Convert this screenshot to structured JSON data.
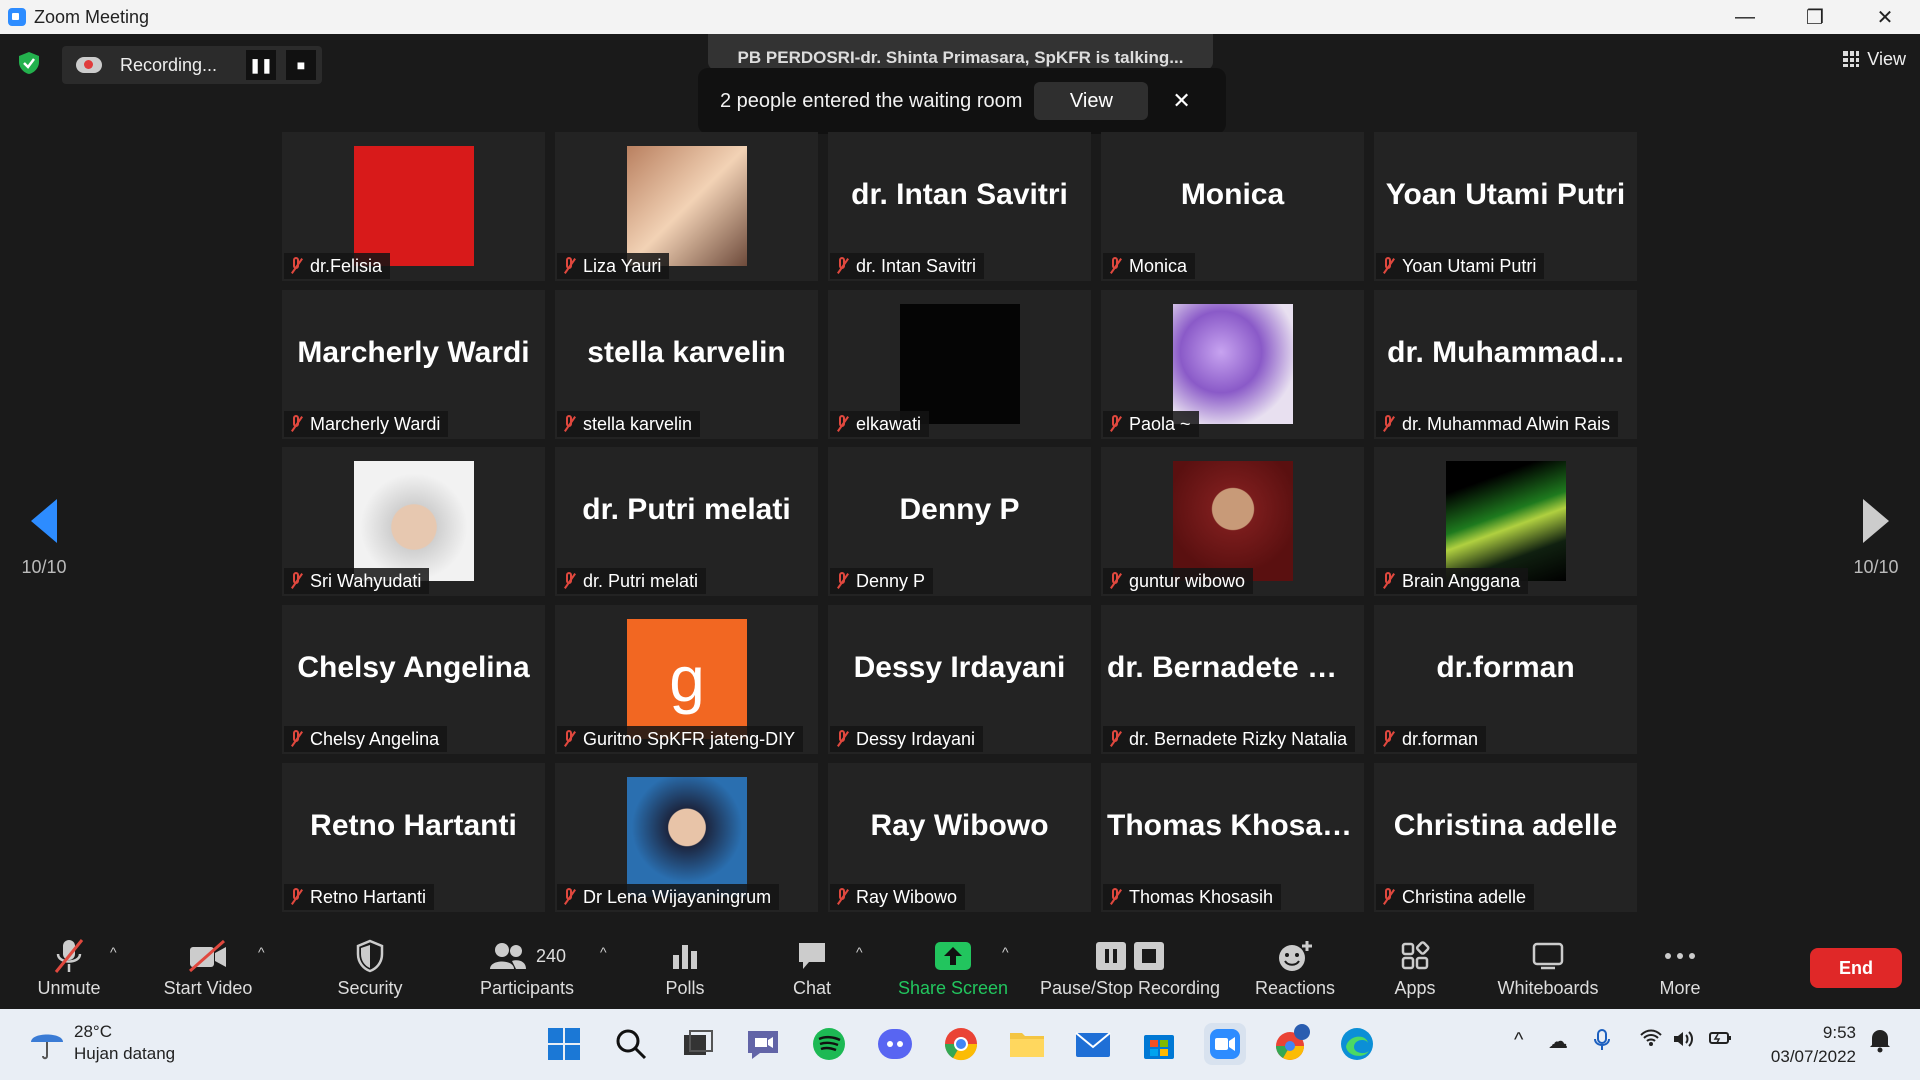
{
  "window": {
    "title": "Zoom Meeting",
    "min": "—",
    "max": "❐",
    "close": "✕"
  },
  "recording": {
    "text": "Recording...",
    "pause": "❚❚",
    "stop": "■"
  },
  "talking": {
    "text": "PB PERDOSRI-dr. Shinta Primasara, SpKFR is talking..."
  },
  "waiting_room": {
    "text": "2 people entered the waiting room",
    "view_label": "View",
    "close": "✕"
  },
  "view_menu": {
    "label": "View"
  },
  "pagination": {
    "left": "10/10",
    "right": "10/10"
  },
  "participants": [
    {
      "big": "",
      "label": "dr.Felisia",
      "pic": "photo"
    },
    {
      "big": "",
      "label": "Liza Yauri",
      "pic": "photo"
    },
    {
      "big": "dr. Intan Savitri",
      "label": "dr. Intan Savitri"
    },
    {
      "big": "Monica",
      "label": "Monica"
    },
    {
      "big": "Yoan Utami Putri",
      "label": "Yoan Utami Putri"
    },
    {
      "big": "Marcherly Wardi",
      "label": "Marcherly Wardi"
    },
    {
      "big": "stella karvelin",
      "label": "stella karvelin"
    },
    {
      "big": "",
      "label": "elkawati",
      "pic": "photo"
    },
    {
      "big": "",
      "label": "Paola ~",
      "pic": "photo"
    },
    {
      "big": "dr.  Muhammad...",
      "label": "dr. Muhammad Alwin Rais"
    },
    {
      "big": "",
      "label": "Sri Wahyudati",
      "pic": "photo"
    },
    {
      "big": "dr. Putri melati",
      "label": "dr. Putri melati"
    },
    {
      "big": "Denny P",
      "label": "Denny P"
    },
    {
      "big": "",
      "label": "guntur wibowo",
      "pic": "photo"
    },
    {
      "big": "",
      "label": "Brain Anggana",
      "pic": "photo"
    },
    {
      "big": "Chelsy Angelina",
      "label": "Chelsy Angelina"
    },
    {
      "big": "",
      "label": "Guritno SpKFR jateng-DIY",
      "pic": "letter",
      "letter": "g"
    },
    {
      "big": "Dessy Irdayani",
      "label": "Dessy Irdayani"
    },
    {
      "big": "dr.  Bernadete  Ri...",
      "label": "dr. Bernadete Rizky Natalia"
    },
    {
      "big": "dr.forman",
      "label": "dr.forman"
    },
    {
      "big": "Retno Hartanti",
      "label": "Retno Hartanti"
    },
    {
      "big": "",
      "label": "Dr Lena Wijayaningrum",
      "pic": "photo"
    },
    {
      "big": "Ray Wibowo",
      "label": "Ray Wibowo"
    },
    {
      "big": "Thomas Khosasih",
      "label": "Thomas Khosasih"
    },
    {
      "big": "Christina adelle",
      "label": "Christina adelle"
    }
  ],
  "toolbar": {
    "unmute": "Unmute",
    "start_video": "Start Video",
    "security": "Security",
    "participants_count": "240",
    "participants": "Participants",
    "polls": "Polls",
    "chat": "Chat",
    "share_screen": "Share Screen",
    "pause_stop_recording": "Pause/Stop Recording",
    "reactions": "Reactions",
    "apps": "Apps",
    "whiteboards": "Whiteboards",
    "more": "More",
    "end": "End"
  },
  "taskbar": {
    "temp": "28°C",
    "weather": "Hujan datang",
    "time": "9:53",
    "date": "03/07/2022"
  },
  "colors": {
    "accent": "#2d8cff",
    "end": "#e02828",
    "share": "#22c55e",
    "muted": "#e0483e",
    "guritno": "#f26722"
  }
}
